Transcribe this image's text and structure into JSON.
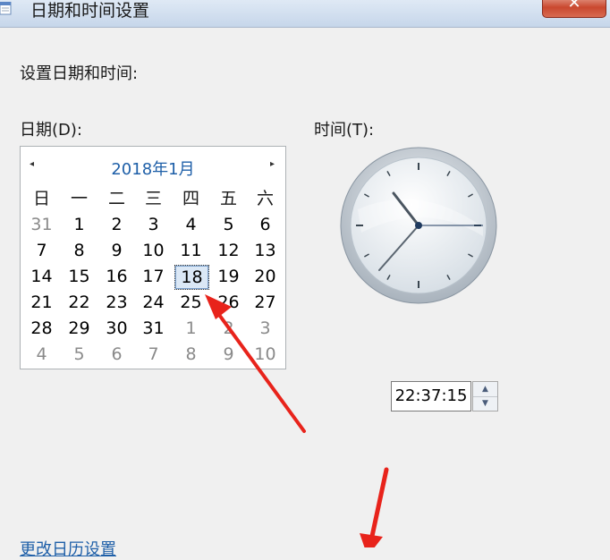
{
  "window": {
    "title": "日期和时间设置",
    "close_label": "✕"
  },
  "instructions": "设置日期和时间:",
  "date": {
    "label": "日期(D):",
    "month_title": "2018年1月",
    "prev": "◂",
    "next": "▸",
    "weekdays": [
      "日",
      "一",
      "二",
      "三",
      "四",
      "五",
      "六"
    ],
    "weeks": [
      [
        "31",
        "1",
        "2",
        "3",
        "4",
        "5",
        "6"
      ],
      [
        "7",
        "8",
        "9",
        "10",
        "11",
        "12",
        "13"
      ],
      [
        "14",
        "15",
        "16",
        "17",
        "18",
        "19",
        "20"
      ],
      [
        "21",
        "22",
        "23",
        "24",
        "25",
        "26",
        "27"
      ],
      [
        "28",
        "29",
        "30",
        "31",
        "1",
        "2",
        "3"
      ],
      [
        "4",
        "5",
        "6",
        "7",
        "8",
        "9",
        "10"
      ]
    ],
    "selected_day": "18"
  },
  "time": {
    "label": "时间(T):",
    "value": "22:37:15",
    "spin_up": "▲",
    "spin_down": "▼"
  },
  "link": "更改日历设置",
  "colors": {
    "accent": "#1e5fa8",
    "arrow": "#e8231b"
  }
}
